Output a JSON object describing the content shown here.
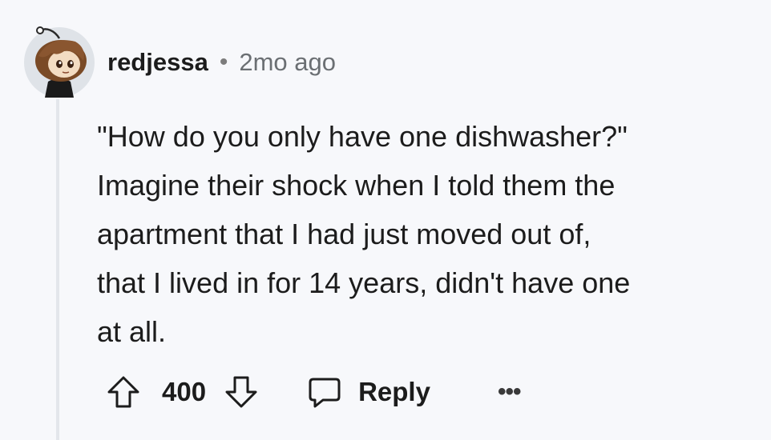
{
  "comment": {
    "author": "redjessa",
    "separator": "•",
    "time_ago": "2mo ago",
    "body_lines": [
      "\"How do you only have one dishwasher?\"",
      "Imagine their shock when I told them the",
      "apartment that I had just moved out of,",
      "that I lived in for 14 years, didn't have one",
      "at all."
    ]
  },
  "actions": {
    "score": "400",
    "reply_label": "Reply",
    "more_label": "•••"
  },
  "icons": {
    "upvote": "arrow-up-icon",
    "downvote": "arrow-down-icon",
    "reply": "speech-bubble-icon",
    "more": "ellipsis-icon"
  }
}
